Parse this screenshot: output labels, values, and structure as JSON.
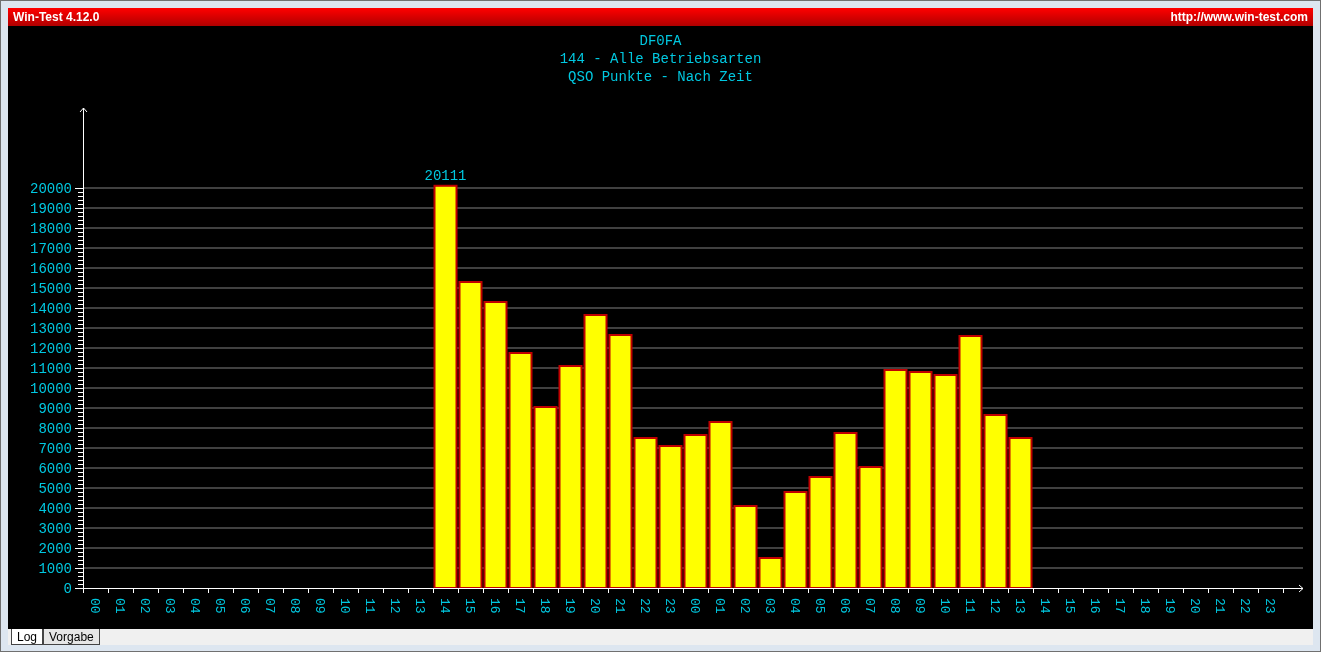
{
  "window": {
    "title": "Win-Test 4.12.0",
    "url": "http://www.win-test.com"
  },
  "chart": {
    "header": [
      "DF0FA",
      "144 - Alle Betriebsarten",
      "QSO Punkte - Nach Zeit"
    ],
    "chart_data": {
      "type": "bar",
      "categories": [
        "00",
        "01",
        "02",
        "03",
        "04",
        "05",
        "06",
        "07",
        "08",
        "09",
        "10",
        "11",
        "12",
        "13",
        "14",
        "15",
        "16",
        "17",
        "18",
        "19",
        "20",
        "21",
        "22",
        "23",
        "00",
        "01",
        "02",
        "03",
        "04",
        "05",
        "06",
        "07",
        "08",
        "09",
        "10",
        "11",
        "12",
        "13",
        "14",
        "15",
        "16",
        "17",
        "18",
        "19",
        "20",
        "21",
        "22",
        "23"
      ],
      "series": [
        {
          "color": "#ffff00",
          "values": [
            null,
            null,
            null,
            null,
            null,
            null,
            null,
            null,
            null,
            null,
            null,
            null,
            null,
            null,
            20111,
            15300,
            14300,
            11750,
            9050,
            11100,
            13650,
            12650,
            7500,
            7100,
            7650,
            8300,
            4100,
            1500,
            4800,
            5550,
            7750,
            6050,
            10900,
            10800,
            10650,
            12600,
            8650,
            7500,
            null,
            null,
            null,
            null,
            null,
            null,
            null,
            null,
            null,
            null
          ]
        }
      ],
      "grid": true,
      "ylim": [
        0,
        24000
      ],
      "yticks": [
        0,
        1000,
        2000,
        3000,
        4000,
        5000,
        6000,
        7000,
        8000,
        9000,
        10000,
        11000,
        12000,
        13000,
        14000,
        15000,
        16000,
        17000,
        18000,
        19000,
        20000
      ],
      "annotations": [
        "20111"
      ]
    }
  },
  "tabs": [
    {
      "label": "Log",
      "selected": true
    },
    {
      "label": "Vorgabe",
      "selected": false
    }
  ]
}
